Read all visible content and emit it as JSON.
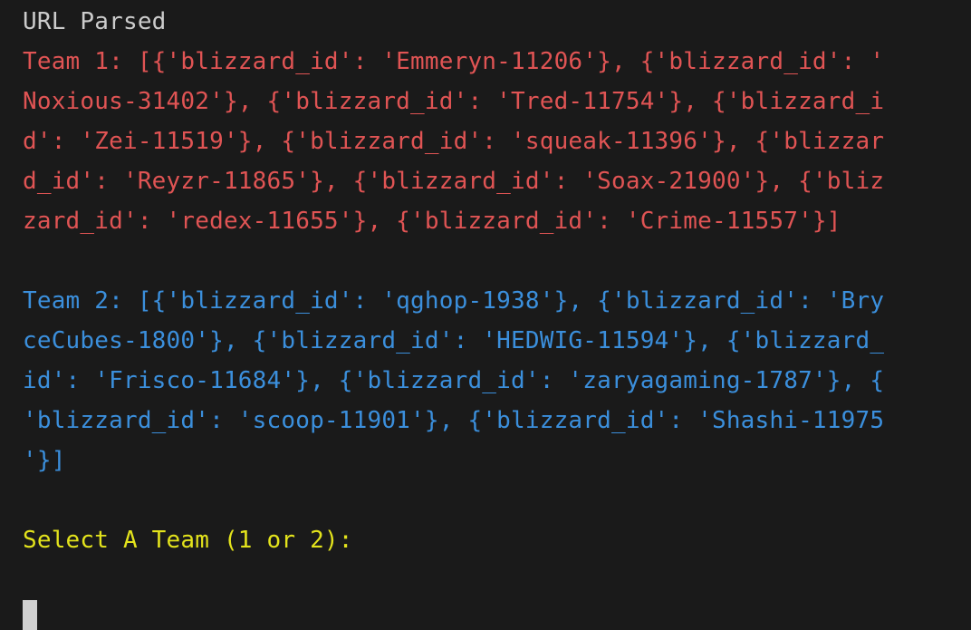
{
  "terminal": {
    "status_line": "URL Parsed",
    "team1": {
      "lines": [
        "Team 1: [{'blizzard_id': 'Emmeryn-11206'}, {'blizzard_id': '",
        "Noxious-31402'}, {'blizzard_id': 'Tred-11754'}, {'blizzard_i",
        "d': 'Zei-11519'}, {'blizzard_id': 'squeak-11396'}, {'blizzar",
        "d_id': 'Reyzr-11865'}, {'blizzard_id': 'Soax-21900'}, {'bliz",
        "zard_id': 'redex-11655'}, {'blizzard_id': 'Crime-11557'}]"
      ]
    },
    "team2": {
      "lines": [
        "Team 2: [{'blizzard_id': 'qghop-1938'}, {'blizzard_id': 'Bry",
        "ceCubes-1800'}, {'blizzard_id': 'HEDWIG-11594'}, {'blizzard_",
        "id': 'Frisco-11684'}, {'blizzard_id': 'zaryagaming-1787'}, {",
        "'blizzard_id': 'scoop-11901'}, {'blizzard_id': 'Shashi-11975",
        "'}]"
      ]
    },
    "prompt": "Select A Team (1 or 2):",
    "colors": {
      "background": "#1a1a1a",
      "plain_text": "#cccccc",
      "team1_text": "#e05454",
      "team2_text": "#3b8fdc",
      "prompt_text": "#e3e31c",
      "cursor": "#d0d0d0"
    }
  }
}
